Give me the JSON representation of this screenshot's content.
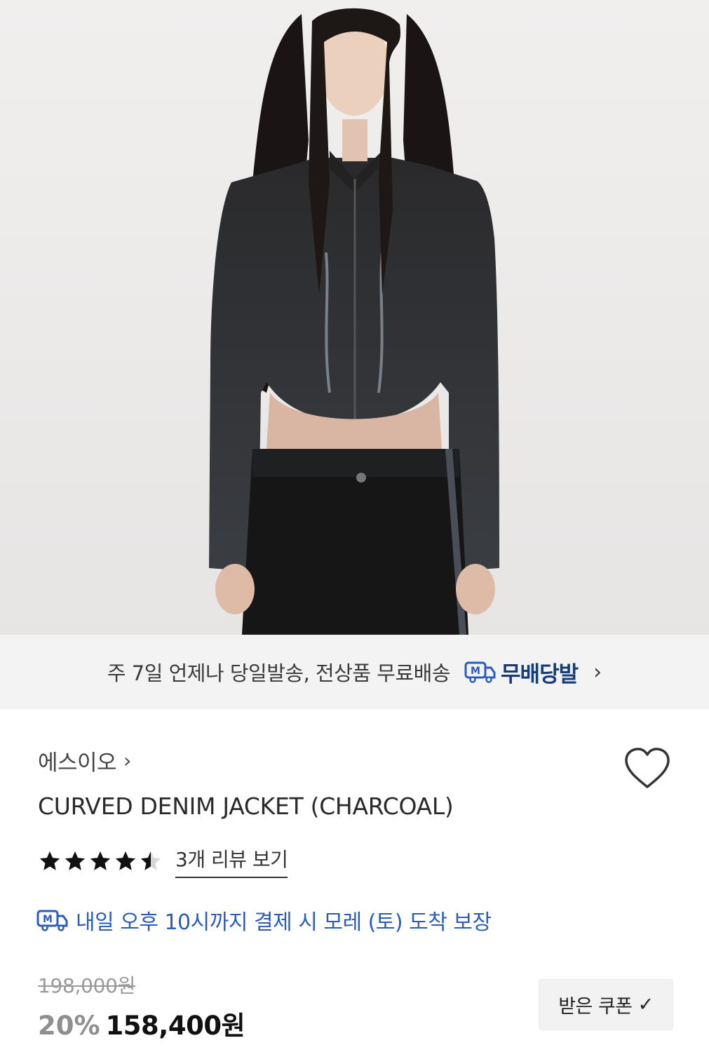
{
  "hero": {
    "image_alt": "CURVED DENIM JACKET (CHARCOAL)"
  },
  "banner": {
    "text": "주 7일 언제나 당일발송, 전상품 무료배송",
    "badge_icon": "m-truck-icon",
    "badge_label": "무배당발",
    "chevron": "›"
  },
  "product": {
    "brand": "에스이오",
    "brand_chevron": "›",
    "title": "CURVED DENIM JACKET (CHARCOAL)",
    "rating": 4.5,
    "review_link": "3개 리뷰 보기",
    "delivery_notice": "내일 오후 10시까지 결제 시 모레 (토) 도착 보장",
    "original_price": "198,000원",
    "discount": "20%",
    "price": "158,400원",
    "coupon_button": "받은 쿠폰",
    "coupon_check": "✓"
  },
  "colors": {
    "accent_blue": "#2c5bbf",
    "badge_navy": "#173d78",
    "discount_gray": "#8f8f8f"
  }
}
